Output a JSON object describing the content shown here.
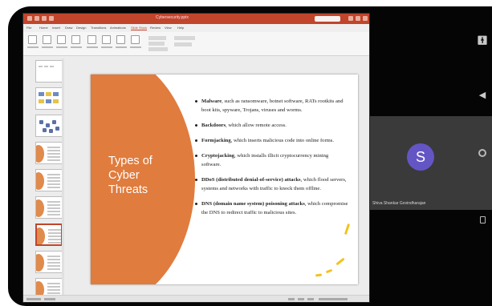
{
  "window": {
    "title": "Cybersecurity.pptx",
    "tabs": [
      "File",
      "Home",
      "Insert",
      "Draw",
      "Design",
      "Transitions",
      "Animations",
      "Slide Show",
      "Review",
      "View",
      "Help"
    ],
    "active_tab": "Slide Show",
    "zoom": "",
    "colors": {
      "titlebar": "#c0452b",
      "accent_orange": "#e07c3e",
      "highlight_yellow": "#f2c31f",
      "avatar": "#6455c5"
    }
  },
  "thumbnails": {
    "numbers": [
      "",
      "",
      "",
      "",
      "",
      "",
      "",
      "",
      ""
    ],
    "selected_index": 6
  },
  "slide": {
    "title": "Types of\nCyber\nThreats",
    "bullets": [
      {
        "bold": "Malware",
        "text": ", such as ransomware, botnet software, RATs rootkits and boot kits, spyware, Trojans, viruses and worms."
      },
      {
        "bold": "Backdoors",
        "text": ", which allow remote access."
      },
      {
        "bold": "Formjacking",
        "text": ", which inserts malicious code into online forms."
      },
      {
        "bold": "Cryptojacking",
        "text": ", which installs illicit cryptocurrency mining software."
      },
      {
        "bold": "DDoS (distributed denial-of-service) attacks",
        "text": ", which flood servers, systems and networks with traffic to knock them offline."
      },
      {
        "bold": "DNS (domain name system) poisoning attacks",
        "text": ", which compromise the DNS to redirect traffic to malicious sites."
      }
    ]
  },
  "participant": {
    "initial": "S",
    "name": "Shiva Shankar Govindharajan"
  },
  "rail_icons": [
    "accessibility-icon",
    "back-icon",
    "home-icon",
    "recents-icon"
  ]
}
